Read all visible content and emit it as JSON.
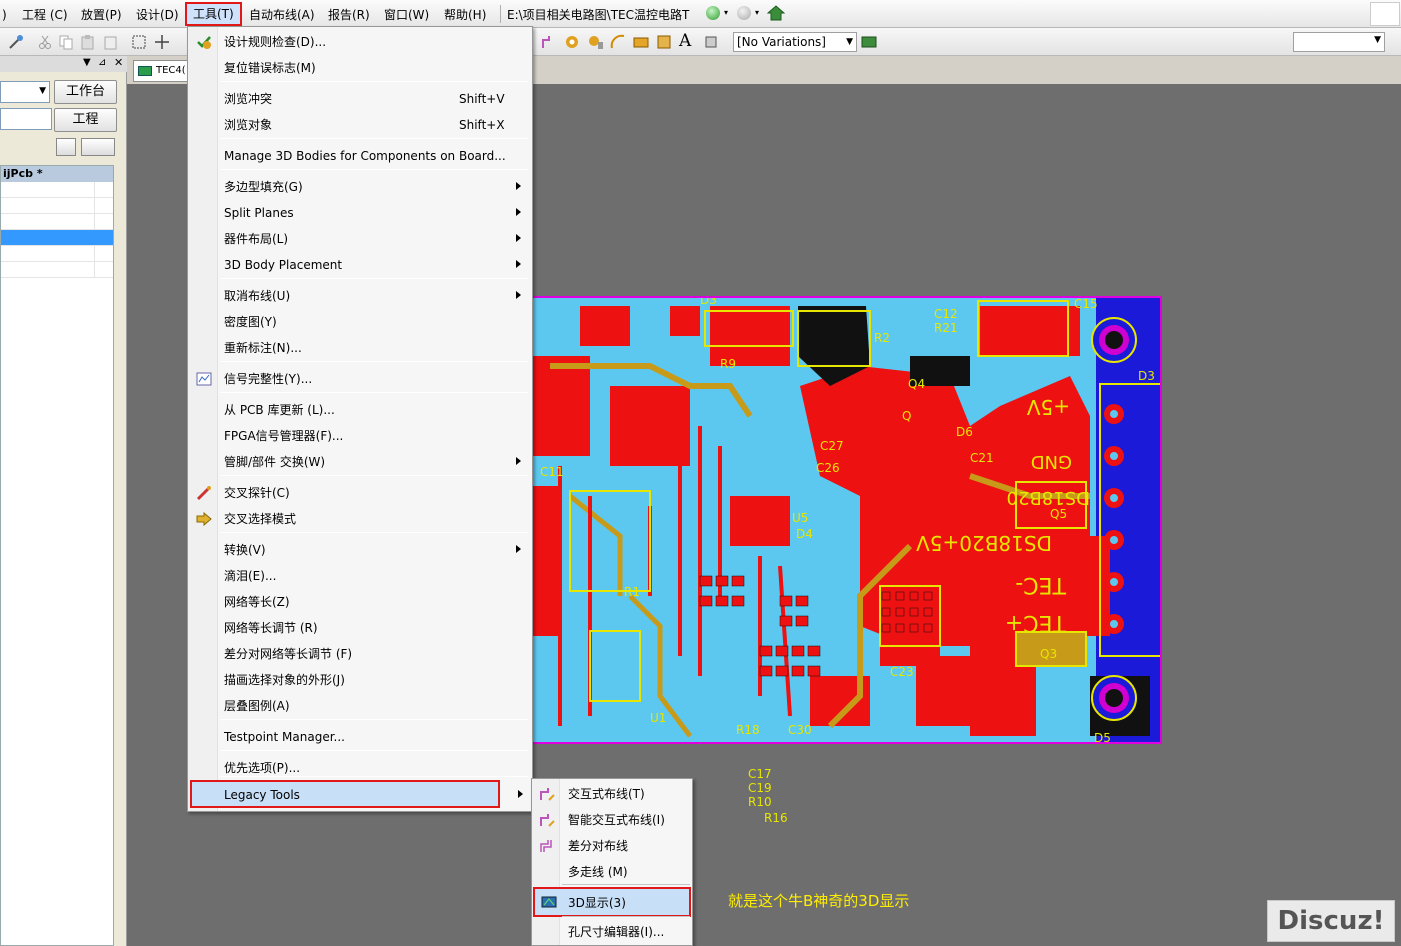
{
  "menubar": {
    "items": [
      ")",
      "工程 (C)",
      "放置(P)",
      "设计(D)",
      "工具(T)",
      "自动布线(A)",
      "报告(R)",
      "窗口(W)",
      "帮助(H)"
    ],
    "path": "E:\\项目相关电路图\\TEC温控电路T"
  },
  "toolbar": {
    "variations": "[No Variations]"
  },
  "left_panel": {
    "workspace_button": "工作台",
    "project_button": "工程",
    "project_header": "ijPcb *"
  },
  "document_tab": {
    "label": "TEC4("
  },
  "tools_menu": {
    "items": [
      {
        "label": "设计规则检查(D)...",
        "shortcut": "",
        "submenu": false,
        "icon": "drc-icon"
      },
      {
        "label": "复位错误标志(M)",
        "shortcut": "",
        "submenu": false,
        "icon": ""
      },
      {
        "label": "浏览冲突",
        "shortcut": "Shift+V",
        "submenu": false,
        "icon": ""
      },
      {
        "label": "浏览对象",
        "shortcut": "Shift+X",
        "submenu": false,
        "icon": ""
      },
      {
        "label": "Manage 3D Bodies for Components on Board...",
        "shortcut": "",
        "submenu": false,
        "icon": ""
      },
      {
        "label": "多边型填充(G)",
        "shortcut": "",
        "submenu": true,
        "icon": ""
      },
      {
        "label": "Split Planes",
        "shortcut": "",
        "submenu": true,
        "icon": ""
      },
      {
        "label": "器件布局(L)",
        "shortcut": "",
        "submenu": true,
        "icon": ""
      },
      {
        "label": "3D Body Placement",
        "shortcut": "",
        "submenu": true,
        "icon": ""
      },
      {
        "label": "取消布线(U)",
        "shortcut": "",
        "submenu": true,
        "icon": ""
      },
      {
        "label": "密度图(Y)",
        "shortcut": "",
        "submenu": false,
        "icon": ""
      },
      {
        "label": "重新标注(N)...",
        "shortcut": "",
        "submenu": false,
        "icon": ""
      },
      {
        "label": "信号完整性(Y)...",
        "shortcut": "",
        "submenu": false,
        "icon": "signal-integrity-icon"
      },
      {
        "label": "从 PCB 库更新 (L)...",
        "shortcut": "",
        "submenu": false,
        "icon": ""
      },
      {
        "label": "FPGA信号管理器(F)...",
        "shortcut": "",
        "submenu": false,
        "icon": ""
      },
      {
        "label": "管脚/部件 交换(W)",
        "shortcut": "",
        "submenu": true,
        "icon": ""
      },
      {
        "label": "交叉探针(C)",
        "shortcut": "",
        "submenu": false,
        "icon": "cross-probe-icon"
      },
      {
        "label": "交叉选择模式",
        "shortcut": "",
        "submenu": false,
        "icon": "cross-select-icon"
      },
      {
        "label": "转换(V)",
        "shortcut": "",
        "submenu": true,
        "icon": ""
      },
      {
        "label": "滴泪(E)...",
        "shortcut": "",
        "submenu": false,
        "icon": ""
      },
      {
        "label": "网络等长(Z)",
        "shortcut": "",
        "submenu": false,
        "icon": ""
      },
      {
        "label": "网络等长调节 (R)",
        "shortcut": "",
        "submenu": false,
        "icon": ""
      },
      {
        "label": "差分对网络等长调节 (F)",
        "shortcut": "",
        "submenu": false,
        "icon": ""
      },
      {
        "label": "描画选择对象的外形(J)",
        "shortcut": "",
        "submenu": false,
        "icon": ""
      },
      {
        "label": "层叠图例(A)",
        "shortcut": "",
        "submenu": false,
        "icon": ""
      },
      {
        "label": "Testpoint Manager...",
        "shortcut": "",
        "submenu": false,
        "icon": ""
      },
      {
        "label": "优先选项(P)...",
        "shortcut": "",
        "submenu": false,
        "icon": ""
      },
      {
        "label": "Legacy Tools",
        "shortcut": "",
        "submenu": true,
        "icon": ""
      }
    ]
  },
  "legacy_submenu": {
    "items": [
      {
        "label": "交互式布线(T)",
        "icon": "interactive-route-icon"
      },
      {
        "label": "智能交互式布线(I)",
        "icon": "smart-route-icon"
      },
      {
        "label": "差分对布线",
        "icon": "diff-pair-route-icon"
      },
      {
        "label": "多走线 (M)",
        "icon": ""
      },
      {
        "label": "3D显示(3)",
        "icon": "3d-view-icon"
      },
      {
        "label": "孔尺寸编辑器(I)...",
        "icon": ""
      }
    ]
  },
  "pcb_labels": {
    "floating": [
      "C17",
      "C19",
      "R10",
      "R16"
    ]
  },
  "annotation": "就是这个牛B神奇的3D显示",
  "watermark": "Discuz!",
  "colors": {
    "canvas": "#6e6e6e",
    "pcb_bottom_copper": "#5cc8f0",
    "pcb_top_copper": "#ee1111",
    "silkscreen": "#e6e600",
    "board_outline": "#e000e0",
    "highlight_border": "#e21818"
  }
}
